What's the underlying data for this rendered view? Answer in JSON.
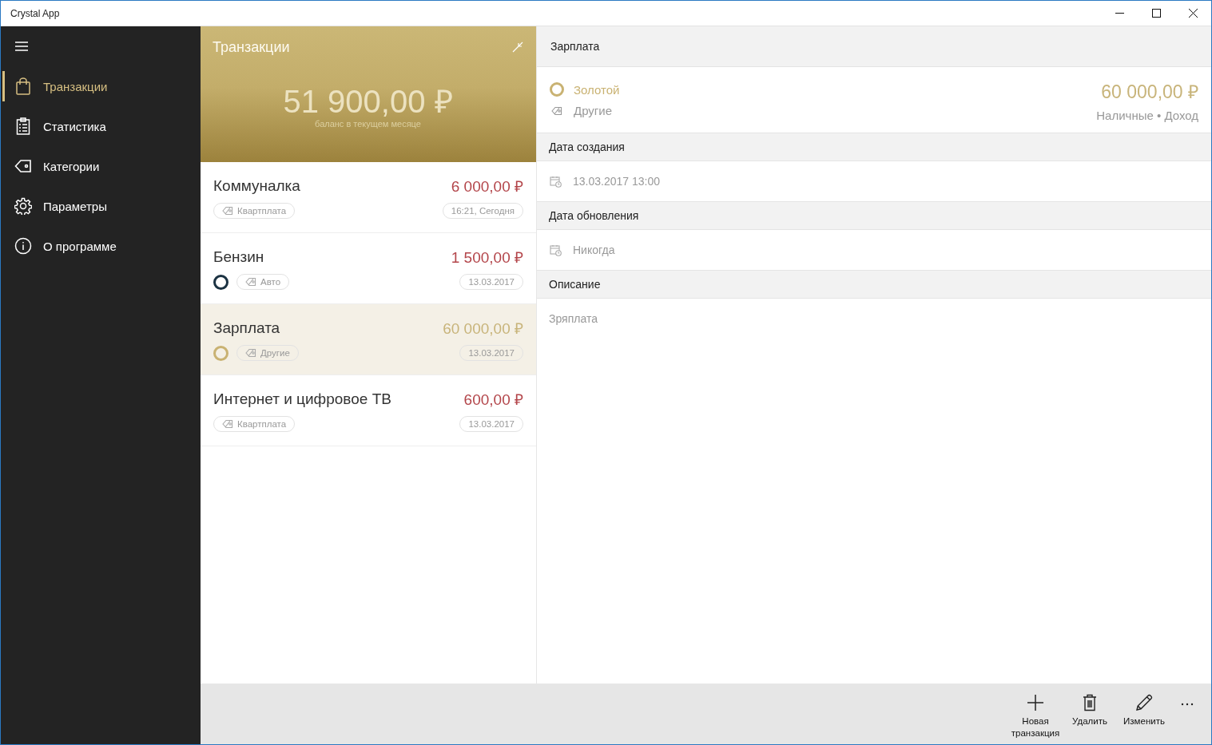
{
  "window": {
    "title": "Crystal App"
  },
  "sidebar": {
    "items": [
      {
        "label": "Транзакции",
        "kind": "bag",
        "selected": true
      },
      {
        "label": "Статистика",
        "kind": "clipboard",
        "selected": false
      },
      {
        "label": "Категории",
        "kind": "tag",
        "selected": false
      },
      {
        "label": "Параметры",
        "kind": "gear",
        "selected": false
      },
      {
        "label": "О программе",
        "kind": "info",
        "selected": false
      }
    ]
  },
  "list": {
    "title": "Транзакции",
    "balance": "51 900,00 ₽",
    "balance_caption": "баланс в текущем месяце",
    "items": [
      {
        "title": "Коммуналка",
        "amount": "6 000,00 ₽",
        "kind": "expense",
        "tag": "Квартплата",
        "date": "16:21, Сегодня",
        "selected": false
      },
      {
        "title": "Бензин",
        "amount": "1 500,00 ₽",
        "kind": "expense",
        "tag": "Авто",
        "date": "13.03.2017",
        "color": "#1b3242",
        "selected": false
      },
      {
        "title": "Зарплата",
        "amount": "60 000,00 ₽",
        "kind": "income",
        "tag": "Другие",
        "date": "13.03.2017",
        "color": "#c9b272",
        "selected": true
      },
      {
        "title": "Интернет и цифровое ТВ",
        "amount": "600,00 ₽",
        "kind": "expense",
        "tag": "Квартплата",
        "date": "13.03.2017",
        "selected": false
      }
    ]
  },
  "detail": {
    "title": "Зарплата",
    "color_name": "Золотой",
    "color": "#c9b272",
    "category": "Другие",
    "amount": "60 000,00 ₽",
    "kind": "income",
    "meta": "Наличные • Доход",
    "sections": [
      {
        "heading": "Дата создания",
        "value": "13.03.2017 13:00",
        "kind": "date"
      },
      {
        "heading": "Дата обновления",
        "value": "Никогда",
        "kind": "date"
      },
      {
        "heading": "Описание",
        "value": "Зряплата",
        "kind": "text"
      }
    ]
  },
  "commands": [
    {
      "label": "Новая транзакция",
      "kind": "add"
    },
    {
      "label": "Удалить",
      "kind": "delete"
    },
    {
      "label": "Изменить",
      "kind": "edit"
    }
  ]
}
